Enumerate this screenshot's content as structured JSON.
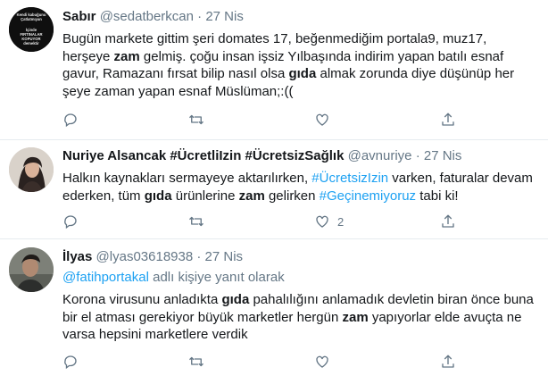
{
  "tweets": [
    {
      "name": "Sabır",
      "handle": "@sedatberkcan",
      "separator": "·",
      "date": "27 Nis",
      "avatar_text": [
        "Kendi kabuğunu",
        "Çatlatmıyan",
        "",
        "İçinde",
        "FIRTINALAR",
        "KOPUYOR",
        "demektir"
      ],
      "body": [
        {
          "t": "Bugün markete gittim şeri domates 17, beğenmediğim portala9, muz17, herşeye "
        },
        {
          "t": "zam",
          "b": true
        },
        {
          "t": " gelmiş. çoğu insan işsiz Yılbaşında indirim yapan batılı esnaf gavur, Ramazanı fırsat bilip nasıl olsa "
        },
        {
          "t": "gıda",
          "b": true
        },
        {
          "t": " almak zorunda diye düşünüp her şeye zaman yapan esnaf Müslüman;:(("
        }
      ],
      "counts": {
        "reply": "",
        "retweet": "",
        "like": ""
      }
    },
    {
      "name": "Nuriye Alsancak #ÜcretliIzin #ÜcretsizSağlık",
      "handle": "@avnuriye",
      "separator": "·",
      "date": "27 Nis",
      "body": [
        {
          "t": "Halkın kaynakları sermayeye aktarılırken, "
        },
        {
          "t": "#ÜcretsizIzin",
          "l": true
        },
        {
          "t": " varken, faturalar devam ederken, tüm "
        },
        {
          "t": "gıda",
          "b": true
        },
        {
          "t": " ürünlerine "
        },
        {
          "t": "zam",
          "b": true
        },
        {
          "t": " gelirken "
        },
        {
          "t": "#Geçinemiyoruz",
          "l": true
        },
        {
          "t": " tabi ki!"
        }
      ],
      "counts": {
        "reply": "",
        "retweet": "",
        "like": "2"
      }
    },
    {
      "name": "İlyas",
      "handle": "@lyas03618938",
      "separator": "·",
      "date": "27 Nis",
      "reply_to": {
        "user": "@fatihportakal",
        "suffix": " adlı kişiye yanıt olarak"
      },
      "body": [
        {
          "t": "Korona virusunu anladıkta "
        },
        {
          "t": "gıda",
          "b": true
        },
        {
          "t": " pahalılığını anlamadık devletin biran önce buna bir el atması gerekiyor büyük marketler hergün "
        },
        {
          "t": "zam",
          "b": true
        },
        {
          "t": " yapıyorlar elde avuçta ne varsa hepsini marketlere verdik"
        }
      ],
      "counts": {
        "reply": "",
        "retweet": "",
        "like": ""
      }
    }
  ]
}
